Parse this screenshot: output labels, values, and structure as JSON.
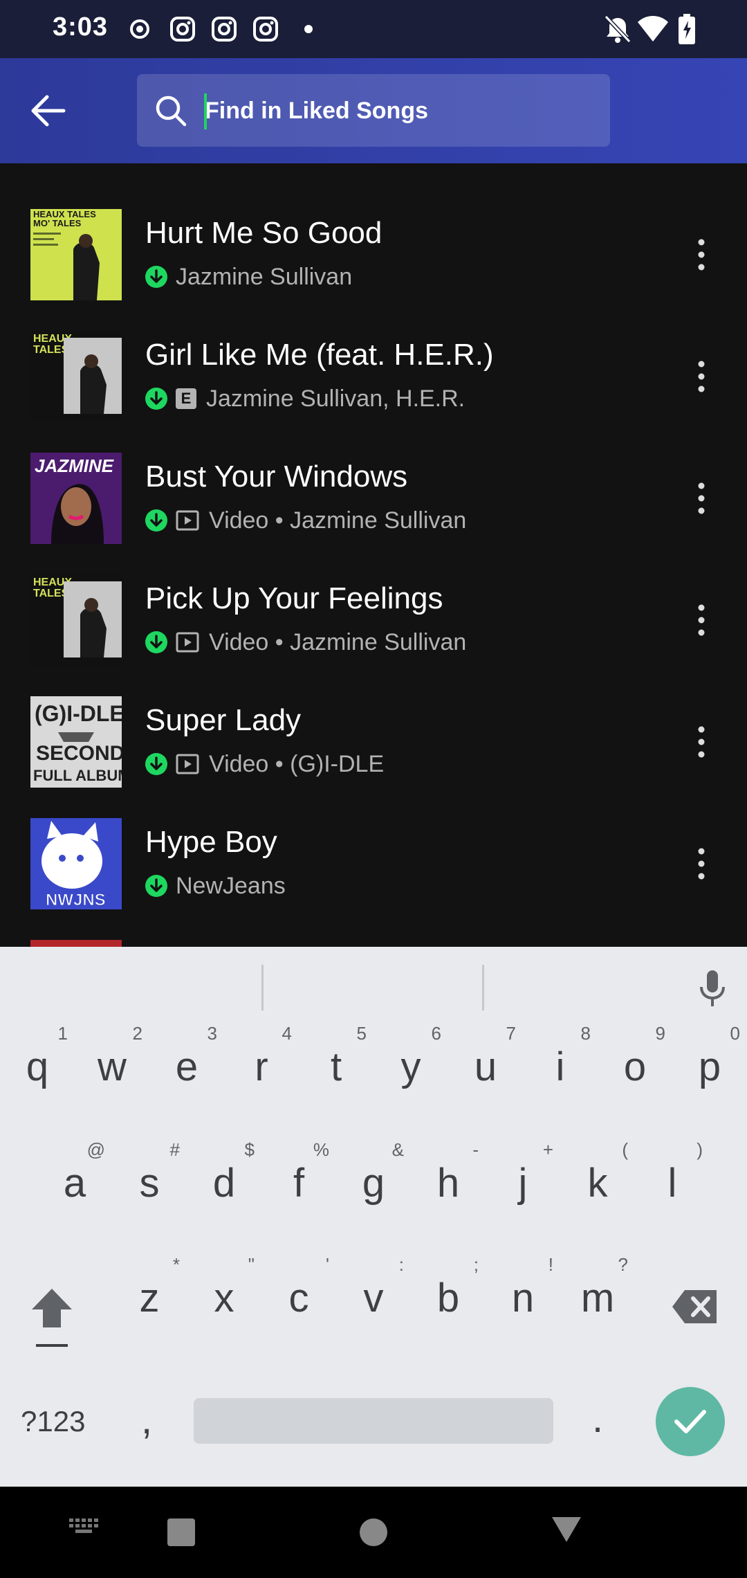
{
  "status_bar": {
    "time": "3:03",
    "left_icons": [
      "record-icon",
      "instagram-icon",
      "instagram-icon",
      "instagram-icon",
      "dot-icon"
    ],
    "right_icons": [
      "notifications-off-icon",
      "wifi-icon",
      "battery-charging-icon"
    ]
  },
  "header": {
    "back_icon": "arrow-left-icon",
    "search": {
      "placeholder": "Find in Liked Songs",
      "value": ""
    }
  },
  "songs": [
    {
      "title": "Hurt Me So Good",
      "subtitle": "Jazmine Sullivan",
      "downloaded": true,
      "explicit": false,
      "video": false,
      "art_text": "HEAUX TALES MO' TALES",
      "art_colors": [
        "#cfe24e",
        "#1a1a1a"
      ]
    },
    {
      "title": "Girl Like Me (feat. H.E.R.)",
      "subtitle": "Jazmine Sullivan, H.E.R.",
      "downloaded": true,
      "explicit": true,
      "explicit_label": "E",
      "video": false,
      "art_text": "HEAUX TALES",
      "art_colors": [
        "#111111",
        "#d5e25a"
      ]
    },
    {
      "title": "Bust Your Windows",
      "subtitle": "Video • Jazmine Sullivan",
      "downloaded": true,
      "explicit": false,
      "video": true,
      "art_text": "JAZMINE",
      "art_colors": [
        "#4b1c6e",
        "#e21b6e"
      ]
    },
    {
      "title": "Pick Up Your Feelings",
      "subtitle": "Video • Jazmine Sullivan",
      "downloaded": true,
      "explicit": false,
      "video": true,
      "art_text": "HEAUX TALES",
      "art_colors": [
        "#111111",
        "#d5e25a"
      ]
    },
    {
      "title": "Super Lady",
      "subtitle": "Video • (G)I-DLE",
      "downloaded": true,
      "explicit": false,
      "video": true,
      "art_text": "(G)I-DLE SECOND FULL ALBUM",
      "art_colors": [
        "#d9d9d9",
        "#222222"
      ]
    },
    {
      "title": "Hype Boy",
      "subtitle": "NewJeans",
      "downloaded": true,
      "explicit": false,
      "video": false,
      "art_text": "NWJNS",
      "art_colors": [
        "#3a49c9",
        "#ffffff"
      ]
    }
  ],
  "colors": {
    "accent_green": "#1ed760",
    "header_blue": "#3645b4",
    "background": "#121212"
  },
  "keyboard": {
    "row1": [
      {
        "k": "q",
        "h": "1"
      },
      {
        "k": "w",
        "h": "2"
      },
      {
        "k": "e",
        "h": "3"
      },
      {
        "k": "r",
        "h": "4"
      },
      {
        "k": "t",
        "h": "5"
      },
      {
        "k": "y",
        "h": "6"
      },
      {
        "k": "u",
        "h": "7"
      },
      {
        "k": "i",
        "h": "8"
      },
      {
        "k": "o",
        "h": "9"
      },
      {
        "k": "p",
        "h": "0"
      }
    ],
    "row2": [
      {
        "k": "a",
        "h": "@"
      },
      {
        "k": "s",
        "h": "#"
      },
      {
        "k": "d",
        "h": "$"
      },
      {
        "k": "f",
        "h": "%"
      },
      {
        "k": "g",
        "h": "&"
      },
      {
        "k": "h",
        "h": "-"
      },
      {
        "k": "j",
        "h": "+"
      },
      {
        "k": "k",
        "h": "("
      },
      {
        "k": "l",
        "h": ")"
      }
    ],
    "row3": [
      {
        "k": "z",
        "h": "*"
      },
      {
        "k": "x",
        "h": "\""
      },
      {
        "k": "c",
        "h": "'"
      },
      {
        "k": "v",
        "h": ":"
      },
      {
        "k": "b",
        "h": ";"
      },
      {
        "k": "n",
        "h": "!"
      },
      {
        "k": "m",
        "h": "?"
      }
    ],
    "symbols_label": "?123",
    "comma": ",",
    "period": "."
  },
  "nav_bar": [
    "keyboard-switch-icon",
    "recents-icon",
    "home-icon",
    "back-triangle-icon"
  ]
}
